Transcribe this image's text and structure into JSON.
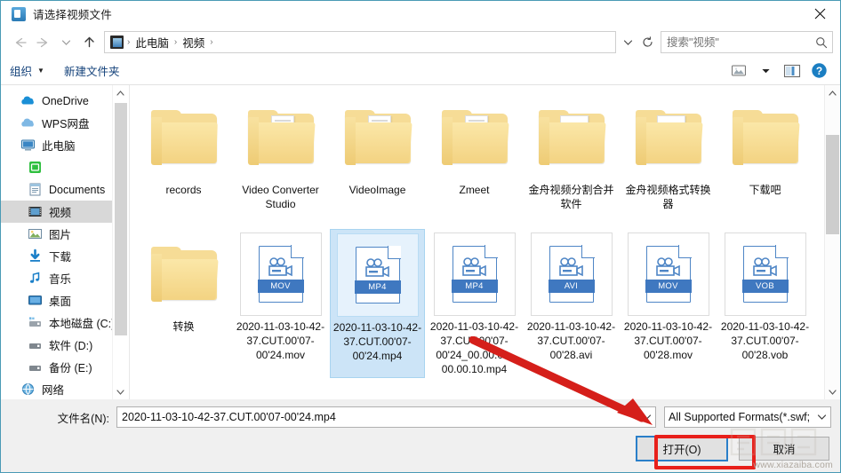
{
  "window": {
    "title": "请选择视频文件",
    "title_icon": "video-file-icon",
    "close_label": "✕"
  },
  "nav": {
    "back_icon": "arrow-left-icon",
    "forward_icon": "arrow-right-icon",
    "recent_icon": "chevron-down-icon",
    "up_icon": "arrow-up-icon",
    "breadcrumb_icon": "videos-folder-icon",
    "breadcrumbs": [
      "此电脑",
      "视频"
    ],
    "separator": "›",
    "address_dropdown_icon": "chevron-down-icon",
    "refresh_icon": "refresh-icon"
  },
  "search": {
    "placeholder": "搜索\"视频\"",
    "value": "",
    "icon": "search-icon"
  },
  "toolbar": {
    "organize_label": "组织",
    "organize_caret": "▼",
    "new_folder_label": "新建文件夹",
    "view_icon": "view-options-icon",
    "view_caret": "▼",
    "preview_pane_icon": "preview-pane-icon",
    "help_icon": "help-icon"
  },
  "sidebar": {
    "items": [
      {
        "label": "OneDrive",
        "icon": "onedrive-cloud-icon",
        "indent": false,
        "selected": false
      },
      {
        "label": "WPS网盘",
        "icon": "wps-cloud-icon",
        "indent": false,
        "selected": false
      },
      {
        "label": "此电脑",
        "icon": "this-pc-icon",
        "indent": false,
        "selected": false
      },
      {
        "label": "",
        "icon": "green-app-icon",
        "indent": true,
        "selected": false
      },
      {
        "label": "Documents",
        "icon": "documents-icon",
        "indent": true,
        "selected": false
      },
      {
        "label": "视频",
        "icon": "videos-icon",
        "indent": true,
        "selected": true
      },
      {
        "label": "图片",
        "icon": "pictures-icon",
        "indent": true,
        "selected": false
      },
      {
        "label": "下载",
        "icon": "downloads-icon",
        "indent": true,
        "selected": false
      },
      {
        "label": "音乐",
        "icon": "music-icon",
        "indent": true,
        "selected": false
      },
      {
        "label": "桌面",
        "icon": "desktop-icon",
        "indent": true,
        "selected": false
      },
      {
        "label": "本地磁盘 (C:)",
        "icon": "system-drive-icon",
        "indent": true,
        "selected": false
      },
      {
        "label": "软件 (D:)",
        "icon": "drive-icon",
        "indent": true,
        "selected": false
      },
      {
        "label": "备份 (E:)",
        "icon": "drive-icon",
        "indent": true,
        "selected": false
      },
      {
        "label": "网络",
        "icon": "network-icon",
        "indent": false,
        "selected": false
      }
    ],
    "scroll_up_icon": "chevron-up-icon",
    "scroll_down_icon": "chevron-down-icon"
  },
  "files": {
    "items": [
      {
        "name": "records",
        "kind": "folder",
        "variant": "plain",
        "selected": false
      },
      {
        "name": "Video Converter Studio",
        "kind": "folder",
        "variant": "docs",
        "selected": false
      },
      {
        "name": "VideoImage",
        "kind": "folder",
        "variant": "docs",
        "selected": false
      },
      {
        "name": "Zmeet",
        "kind": "folder",
        "variant": "docs",
        "selected": false
      },
      {
        "name": "金舟视频分割合并软件",
        "kind": "folder",
        "variant": "disc",
        "selected": false
      },
      {
        "name": "金舟视频格式转换器",
        "kind": "folder",
        "variant": "music",
        "selected": false
      },
      {
        "name": "下载吧",
        "kind": "folder",
        "variant": "open",
        "selected": false
      },
      {
        "name": "转换",
        "kind": "folder",
        "variant": "open",
        "selected": false
      },
      {
        "name": "2020-11-03-10-42-37.CUT.00'07-00'24.mov",
        "kind": "video",
        "ext": "MOV",
        "selected": false
      },
      {
        "name": "2020-11-03-10-42-37.CUT.00'07-00'24.mp4",
        "kind": "video",
        "ext": "MP4",
        "selected": true
      },
      {
        "name": "2020-11-03-10-42-37.CUT.00'07-00'24_00.00.01-00.00.10.mp4",
        "kind": "video",
        "ext": "MP4",
        "selected": false
      },
      {
        "name": "2020-11-03-10-42-37.CUT.00'07-00'28.avi",
        "kind": "video",
        "ext": "AVI",
        "selected": false
      },
      {
        "name": "2020-11-03-10-42-37.CUT.00'07-00'28.mov",
        "kind": "video",
        "ext": "MOV",
        "selected": false
      },
      {
        "name": "2020-11-03-10-42-37.CUT.00'07-00'28.vob",
        "kind": "video",
        "ext": "VOB",
        "selected": false
      }
    ],
    "scroll_up_icon": "chevron-up-icon",
    "scroll_down_icon": "chevron-down-icon"
  },
  "footer": {
    "filename_label": "文件名(N):",
    "filename_value": "2020-11-03-10-42-37.CUT.00'07-00'24.mp4",
    "filename_dropdown_icon": "chevron-down-icon",
    "filter_value": "All Supported Formats(*.swf;",
    "filter_dropdown_icon": "chevron-down-icon",
    "open_button": "打开(O)",
    "cancel_button": "取消"
  },
  "annotations": {
    "arrow": "red-arrow-pointing-to-open-button",
    "highlight_box": "red-box-around-open-button",
    "watermark": "www.xiazaiba.com"
  },
  "colors": {
    "accent": "#2a7fc9",
    "selection": "#cce4f7",
    "annotation_red": "#e8201b",
    "folder_yellow": "#f6dc96",
    "link_blue": "#13417a"
  }
}
